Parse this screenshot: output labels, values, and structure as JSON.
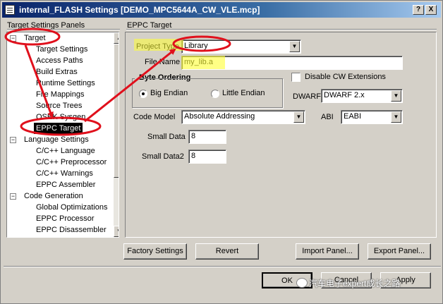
{
  "window": {
    "title": "internal_FLASH Settings [DEMO_MPC5644A_CW_VLE.mcp]",
    "help_label": "?",
    "close_label": "X"
  },
  "left_panel": {
    "title": "Target Settings Panels",
    "tree": [
      {
        "label": "Target",
        "expander": "−",
        "level": 0
      },
      {
        "label": "Target Settings",
        "level": 1
      },
      {
        "label": "Access Paths",
        "level": 1
      },
      {
        "label": "Build Extras",
        "level": 1
      },
      {
        "label": "Runtime Settings",
        "level": 1
      },
      {
        "label": "File Mappings",
        "level": 1
      },
      {
        "label": "Source Trees",
        "level": 1
      },
      {
        "label": "OSEK Sysgen",
        "level": 1
      },
      {
        "label": "EPPC Target",
        "level": 1,
        "selected": true
      },
      {
        "label": "Language Settings",
        "expander": "−",
        "level": 0
      },
      {
        "label": "C/C++ Language",
        "level": 1
      },
      {
        "label": "C/C++ Preprocessor",
        "level": 1
      },
      {
        "label": "C/C++ Warnings",
        "level": 1
      },
      {
        "label": "EPPC Assembler",
        "level": 1
      },
      {
        "label": "Code Generation",
        "expander": "−",
        "level": 0
      },
      {
        "label": "Global Optimizations",
        "level": 1
      },
      {
        "label": "EPPC Processor",
        "level": 1
      },
      {
        "label": "EPPC Disassembler",
        "level": 1
      }
    ]
  },
  "right_panel": {
    "title": "EPPC Target",
    "project_type": {
      "label": "Project Type",
      "value": "Library"
    },
    "file_name": {
      "label": "File Name",
      "value": "my_lib.a"
    },
    "byte_ordering": {
      "label": "Byte Ordering",
      "options": [
        "Big Endian",
        "Little Endian"
      ],
      "selected": "Big Endian"
    },
    "disable_cw": {
      "label": "Disable CW Extensions",
      "checked": false
    },
    "dwarf": {
      "label": "DWARF",
      "value": "DWARF 2.x"
    },
    "code_model": {
      "label": "Code Model",
      "value": "Absolute Addressing"
    },
    "abi": {
      "label": "ABI",
      "value": "EABI"
    },
    "small_data": {
      "label": "Small Data",
      "value": "8"
    },
    "small_data2": {
      "label": "Small Data2",
      "value": "8"
    }
  },
  "buttons": {
    "factory_settings": "Factory Settings",
    "revert": "Revert",
    "import_panel": "Import Panel...",
    "export_panel": "Export Panel...",
    "ok": "OK",
    "cancel": "Cancel",
    "apply": "Apply"
  },
  "watermark": {
    "text": "汽车电子expert成长之路"
  },
  "colors": {
    "annotation": "#e0101c",
    "highlight": "#ffff33",
    "selection": "#000000"
  }
}
